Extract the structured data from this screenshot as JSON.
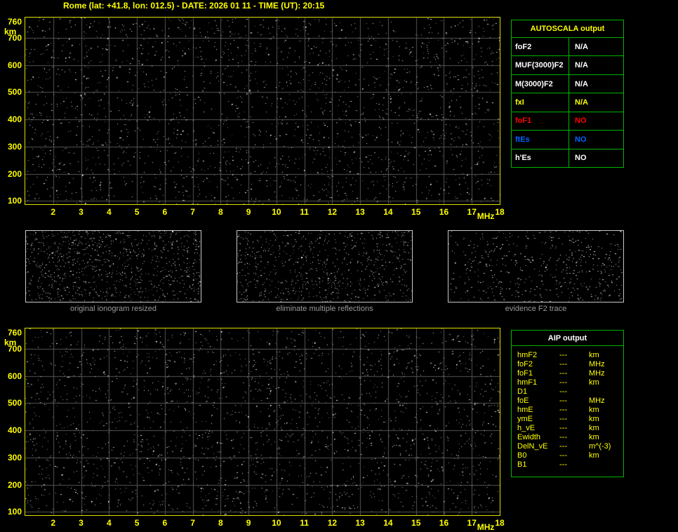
{
  "title": "Rome (lat: +41.8, lon: 012.5) - DATE: 2026 01 11 - TIME (UT): 20:15",
  "colors": {
    "accent_yellow": "#ffff00",
    "plot_border_yellow": "#dede00",
    "table_border_green": "#00b400",
    "grid_gray": "#575757",
    "caption_gray": "#9a9a9a",
    "status_red": "#ff0000",
    "status_blue": "#0064ff",
    "text_white": "#ffffff"
  },
  "ionogram_axes": {
    "y_unit": "km",
    "y_ticks": [
      760,
      700,
      600,
      500,
      400,
      300,
      200,
      100
    ],
    "y_range": [
      88,
      775
    ],
    "x_unit": "MHz",
    "x_ticks": [
      2,
      3,
      4,
      5,
      6,
      7,
      8,
      9,
      10,
      11,
      12,
      13,
      14,
      15,
      16,
      17,
      18
    ],
    "x_range": [
      1,
      18
    ]
  },
  "autoscala": {
    "title": "AUTOSCALA output",
    "rows": [
      {
        "label": "foF2",
        "value": "N/A",
        "color": "#ffffff"
      },
      {
        "label": "MUF(3000)F2",
        "value": "N/A",
        "color": "#ffffff"
      },
      {
        "label": "M(3000)F2",
        "value": "N/A",
        "color": "#ffffff"
      },
      {
        "label": "fxI",
        "value": "N/A",
        "color": "#ffff00"
      },
      {
        "label": "foF1",
        "value": "NO",
        "color": "#ff0000"
      },
      {
        "label": "ftEs",
        "value": "NO",
        "color": "#0064ff"
      },
      {
        "label": "h'Es",
        "value": "NO",
        "color": "#ffffff"
      }
    ]
  },
  "thumbnails": [
    {
      "caption": "original ionogram resized"
    },
    {
      "caption": "eliminate multiple reflections"
    },
    {
      "caption": "evidence F2 trace"
    }
  ],
  "aip": {
    "title": "AIP output",
    "rows": [
      {
        "label": "hmF2",
        "value": "---",
        "unit": "km"
      },
      {
        "label": "foF2",
        "value": "---",
        "unit": "MHz"
      },
      {
        "label": "foF1",
        "value": "---",
        "unit": "MHz"
      },
      {
        "label": "hmF1",
        "value": "---",
        "unit": "km"
      },
      {
        "label": "D1",
        "value": "---",
        "unit": ""
      },
      {
        "label": "foE",
        "value": "---",
        "unit": "MHz"
      },
      {
        "label": "hmE",
        "value": "---",
        "unit": "km"
      },
      {
        "label": "ymE",
        "value": "---",
        "unit": "km"
      },
      {
        "label": "h_vE",
        "value": "---",
        "unit": "km"
      },
      {
        "label": "Ewidth",
        "value": "---",
        "unit": "km"
      },
      {
        "label": "DelN_vE",
        "value": "---",
        "unit": "m^(-3)"
      },
      {
        "label": "B0",
        "value": "---",
        "unit": "km"
      },
      {
        "label": "B1",
        "value": "---",
        "unit": ""
      }
    ]
  }
}
